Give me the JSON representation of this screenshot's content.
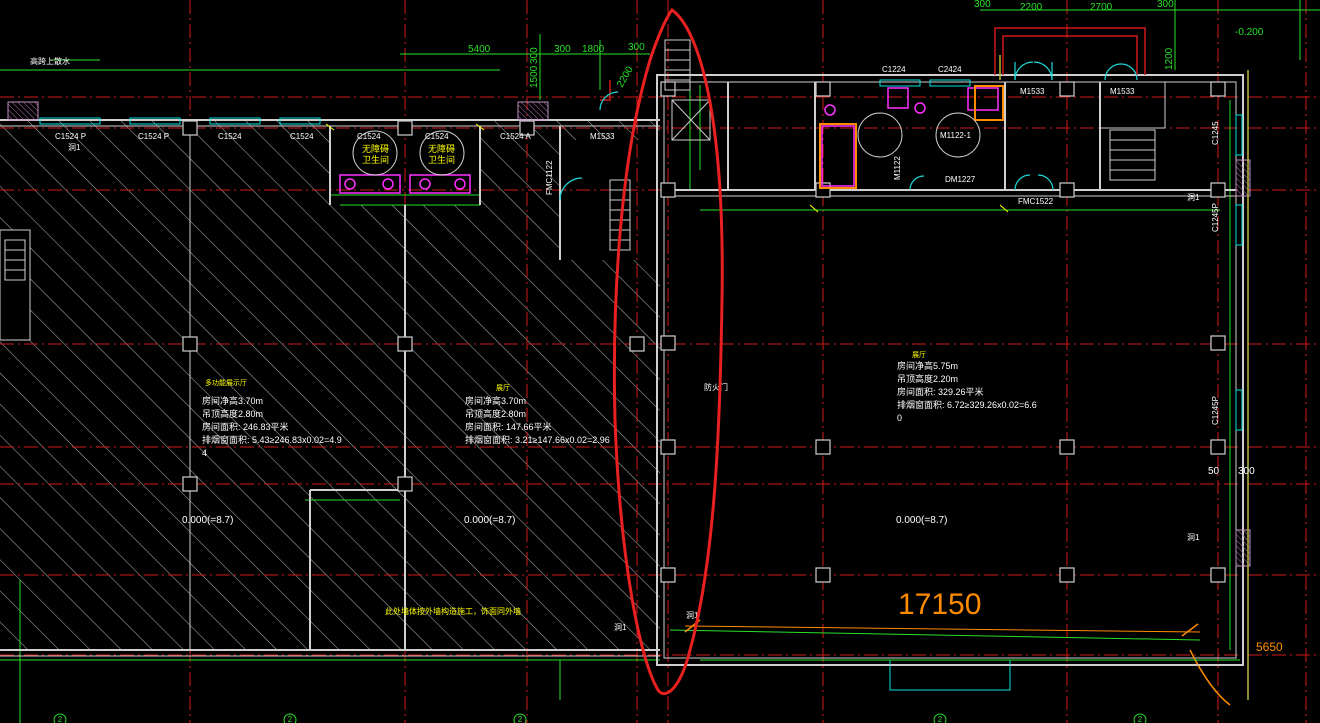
{
  "colors": {
    "background": "#000000",
    "axis": "#d01818",
    "dim": "#28e028",
    "wall": "#cfcfcf",
    "hatch": "#bdbdbd",
    "door": "#20d8d8",
    "fixture": "#ff30ff",
    "text_white": "#ffffff",
    "text_yellow": "#ffff00",
    "text_orange": "#ff8c00",
    "markup": "#e82020",
    "window_cyan": "#00e0e0",
    "column": "#d0d0d0",
    "olive": "#b8b840",
    "purple_hatch": "#c090c0"
  },
  "top_dims": {
    "d300a": "300",
    "d2200": "2200",
    "d2700": "2700",
    "d300b": "300",
    "elev": "-0.200",
    "d5400": "5400",
    "d300c": "300",
    "d1800": "1800",
    "d300d": "300",
    "d1500": "1500",
    "d300v": "300",
    "d1200v": "1200",
    "d2200v": "2200"
  },
  "labels": {
    "rain_pipe": "高跨上散水",
    "w1": "C1524 P",
    "w2": "C1524 P",
    "w3": "C1524",
    "w4": "C1524",
    "w5": "C1524",
    "w6": "C1524",
    "w7": "C1524 A",
    "door_m1533a": "M1533",
    "door_fmc1122": "FMC1122",
    "wc1a": "无障碍",
    "wc1b": "卫生间",
    "wc2a": "无障碍",
    "wc2b": "卫生间",
    "hole1": "洞1",
    "c1224": "C1224",
    "c2424": "C2424",
    "m1533b": "M1533",
    "m1533c": "M1533",
    "m1122": "M1122",
    "m1122b": "M1122-1",
    "dm1227": "DM1227",
    "fmc1522": "FMC1522",
    "hole2": "洞1",
    "hole3": "洞1",
    "hole4": "洞1",
    "hole5": "洞1",
    "fire_door": "防火门",
    "c1245": "C1245",
    "c1245b": "C1245P",
    "c1245c": "C1245P",
    "d50": "50",
    "d300r": "300",
    "big_dim": "17150",
    "dim_5650": "5650",
    "note_bottom": "此处墙体按外墙构造施工，饰面同外墙"
  },
  "room_left": {
    "title": "多功能展示厅",
    "l1": "房间净高3.70m",
    "l2": "吊顶高度2.80m",
    "l3": "房间面积: 246.83平米",
    "l4": "排烟窗面积: 5.43≥246.83x0.02=4.9",
    "l5": "4",
    "elev": "0.000(=8.7)"
  },
  "room_mid": {
    "title": "展厅",
    "l1": "房间净高3.70m",
    "l2": "吊顶高度2.80m",
    "l3": "房间面积: 147.66平米",
    "l4": "排烟窗面积: 3.21≥147.66x0.02=2.96",
    "elev": "0.000(=8.7)"
  },
  "room_right": {
    "title": "展厅",
    "l1": "房间净高5.75m",
    "l2": "吊顶高度2.20m",
    "l3": "房间面积: 329.26平米",
    "l4": "排烟窗面积: 6.72≥329.26x0.02=6.6",
    "l5": "0",
    "elev": "0.000(=8.7)"
  },
  "axis_bubbles": [
    "2",
    "2",
    "2",
    "2",
    "2"
  ]
}
